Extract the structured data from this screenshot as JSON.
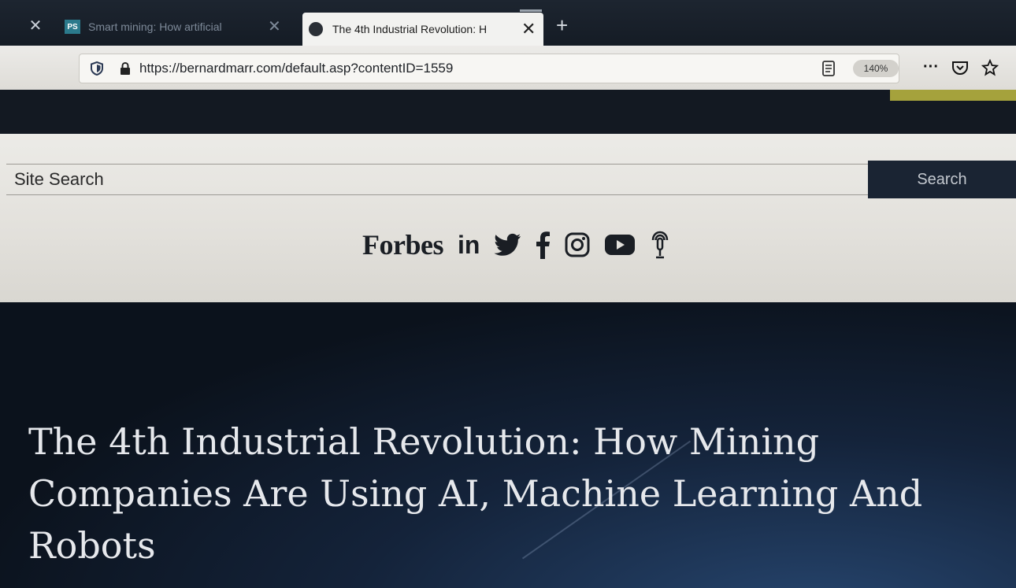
{
  "browser": {
    "tabs": [
      {
        "title": "Smart mining: How artificial",
        "favicon": "PS",
        "active": false
      },
      {
        "title": "The 4th Industrial Revolution: H",
        "active": true
      }
    ],
    "url": "https://bernardmarr.com/default.asp?contentID=1559",
    "zoom": "140%",
    "icons": {
      "tab_close": "close-icon",
      "new_tab": "plus-icon",
      "shield": "tracking-shield-icon",
      "lock": "lock-icon",
      "reader": "reader-view-icon",
      "menu": "more-icon",
      "pocket": "pocket-icon",
      "bookmark": "star-icon"
    }
  },
  "site": {
    "search": {
      "placeholder": "Site Search",
      "button_label": "Search"
    },
    "social": {
      "forbes_label": "Forbes",
      "linkedin_label": "in",
      "icons": [
        "twitter-icon",
        "facebook-icon",
        "instagram-icon",
        "youtube-icon",
        "podcast-icon"
      ]
    },
    "accent_color": "#a5a23c",
    "header_bg": "#131922"
  },
  "article": {
    "title": "The 4th Industrial Revolution: How Mining Companies Are Using AI, Machine Learning And Robots"
  }
}
